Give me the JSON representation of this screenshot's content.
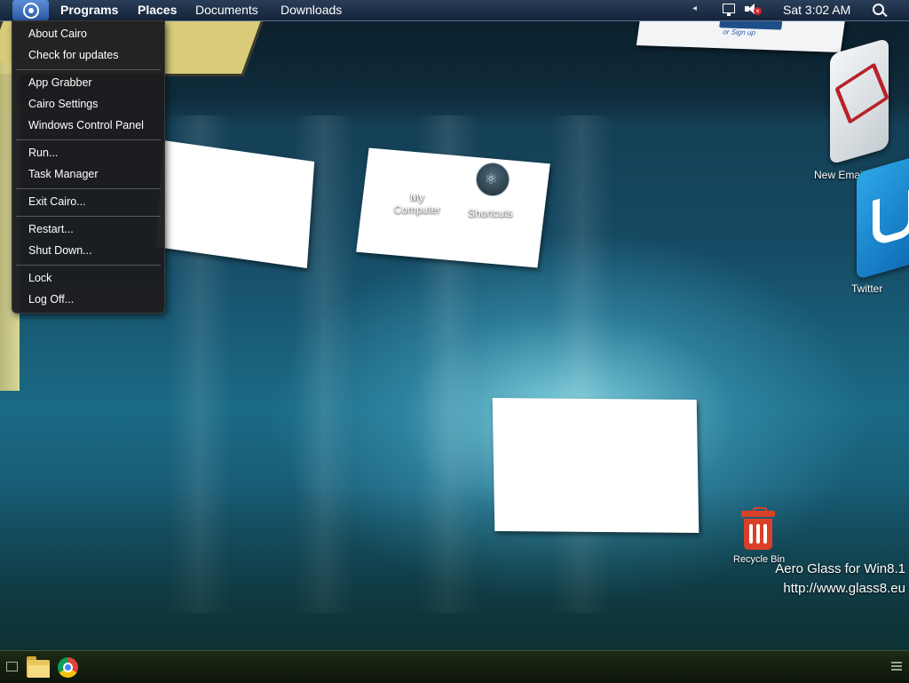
{
  "menubar": {
    "items": {
      "programs": "Programs",
      "places": "Places",
      "documents": "Documents",
      "downloads": "Downloads"
    },
    "clock": "Sat 3:02 AM",
    "tray_arrow": "◂",
    "icons": [
      "cairo-logo-icon",
      "network-icon",
      "volume-muted-icon",
      "search-icon"
    ]
  },
  "cairo_menu": {
    "items": [
      "About Cairo",
      "Check for updates",
      "App Grabber",
      "Cairo Settings",
      "Windows Control Panel",
      "Run...",
      "Task Manager",
      "Exit Cairo...",
      "Restart...",
      "Shut Down...",
      "Lock",
      "Log Off..."
    ]
  },
  "desktop": {
    "icons": {
      "my_computer": "My Computer",
      "shortcuts": "Shortcuts",
      "new_email": "New Email",
      "twitter": "Twitter",
      "recycle_bin": "Recycle Bin"
    },
    "card_text": "or Sign up",
    "watermark": {
      "line1": "Aero Glass for Win8.1",
      "line2": "http://www.glass8.eu"
    }
  },
  "taskbar": {
    "apps": [
      "file-explorer-icon",
      "chrome-icon"
    ]
  },
  "colors": {
    "menubar": "#14243a",
    "cairo_button": "#2c5aa5",
    "menu_background": "#1c1c1e",
    "taskbar": "#0e160b",
    "recycle_bin": "#d84128"
  }
}
